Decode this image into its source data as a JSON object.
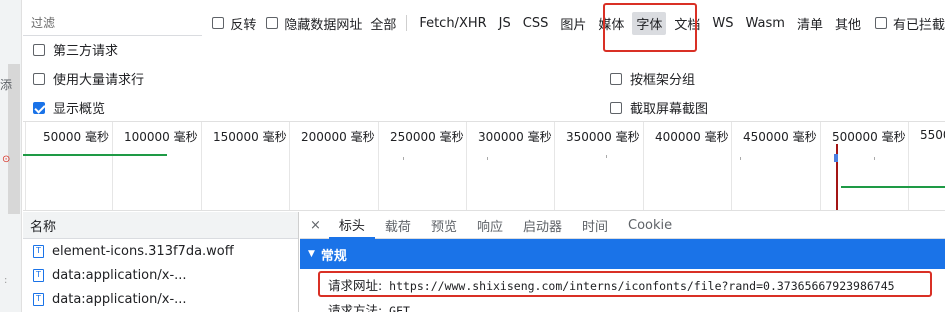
{
  "gutter": {
    "side_text": "添"
  },
  "filter": {
    "placeholder": "过滤",
    "invert_label": "反转",
    "hide_data_urls_label": "隐藏数据网址",
    "types": [
      "全部",
      "Fetch/XHR",
      "JS",
      "CSS",
      "图片",
      "媒体",
      "字体",
      "文档",
      "WS",
      "Wasm",
      "清单",
      "其他"
    ],
    "active_type": "字体",
    "blocked_label": "有已拦截"
  },
  "options": {
    "third_party": "第三方请求",
    "big_rows": "使用大量请求行",
    "group_by_frame": "按框架分组",
    "show_overview": "显示概览",
    "capture_screenshots": "截取屏幕截图",
    "show_overview_checked": true
  },
  "timeline": {
    "ticks": [
      "50000 毫秒",
      "100000 毫秒",
      "150000 毫秒",
      "200000 毫秒",
      "250000 毫秒",
      "300000 毫秒",
      "350000 毫秒",
      "400000 毫秒",
      "450000 毫秒",
      "500000 毫秒",
      "5500"
    ],
    "colors": {
      "bar": "#1e9a45",
      "marker": "#a31515"
    }
  },
  "list": {
    "header": "名称",
    "rows": [
      "element-icons.313f7da.woff",
      "data:application/x-...",
      "data:application/x-..."
    ]
  },
  "detail": {
    "close_glyph": "×",
    "tabs": [
      "标头",
      "载荷",
      "预览",
      "响应",
      "启动器",
      "时间",
      "Cookie"
    ],
    "active_tab": "标头",
    "section_title": "常规",
    "request_url_label": "请求网址:",
    "request_url": "https://www.shixiseng.com/interns/iconfonts/file?rand=0.37365667923986745",
    "request_method_label": "请求方法:",
    "request_method": "GET"
  },
  "accent_color": "#1a73e8",
  "highlight_color": "#d93025"
}
